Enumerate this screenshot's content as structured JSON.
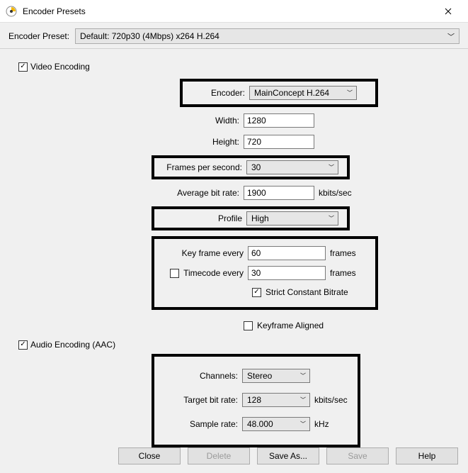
{
  "window": {
    "title": "Encoder Presets"
  },
  "preset": {
    "label": "Encoder Preset:",
    "value": "Default: 720p30 (4Mbps) x264 H.264"
  },
  "video": {
    "section_label": "Video Encoding",
    "encoder_label": "Encoder:",
    "encoder_value": "MainConcept H.264",
    "width_label": "Width:",
    "width_value": "1280",
    "height_label": "Height:",
    "height_value": "720",
    "fps_label": "Frames per second:",
    "fps_value": "30",
    "abr_label": "Average bit rate:",
    "abr_value": "1900",
    "abr_unit": "kbits/sec",
    "profile_label": "Profile",
    "profile_value": "High",
    "keyframe_label": "Key frame every",
    "keyframe_value": "60",
    "keyframe_unit": "frames",
    "timecode_label": "Timecode every",
    "timecode_value": "30",
    "timecode_unit": "frames",
    "strict_cbr_label": "Strict Constant Bitrate",
    "keyframe_aligned_label": "Keyframe Aligned"
  },
  "audio": {
    "section_label": "Audio Encoding (AAC)",
    "channels_label": "Channels:",
    "channels_value": "Stereo",
    "target_br_label": "Target bit rate:",
    "target_br_value": "128",
    "target_br_unit": "kbits/sec",
    "sample_rate_label": "Sample rate:",
    "sample_rate_value": "48.000",
    "sample_rate_unit": "kHz"
  },
  "buttons": {
    "close": "Close",
    "delete": "Delete",
    "save_as": "Save As...",
    "save": "Save",
    "help": "Help"
  }
}
